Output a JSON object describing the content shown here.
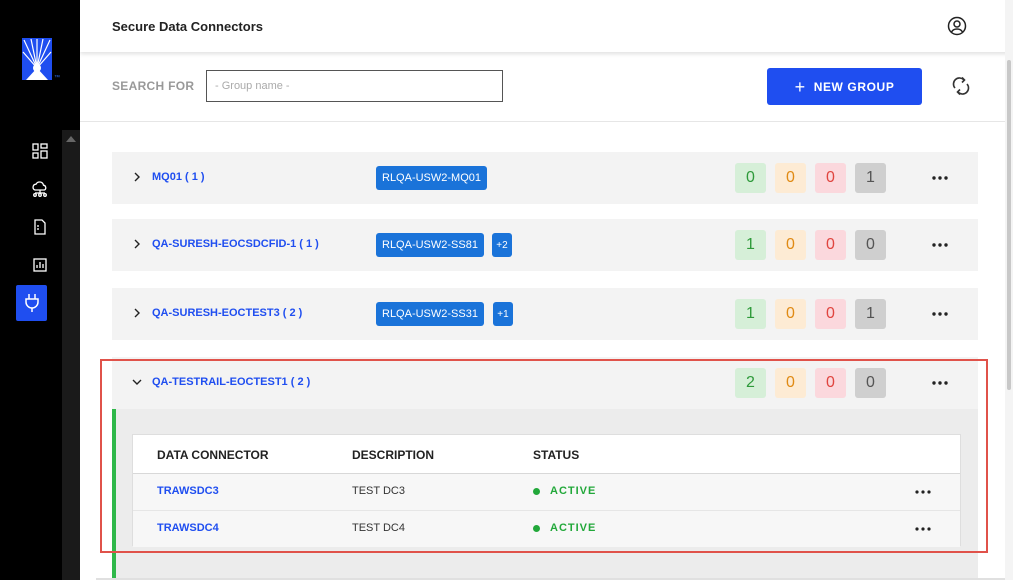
{
  "header": {
    "title": "Secure Data Connectors"
  },
  "sidebar": {
    "items": [
      {
        "icon": "dashboard-icon"
      },
      {
        "icon": "cloud-network-icon"
      },
      {
        "icon": "document-icon"
      },
      {
        "icon": "report-chart-icon"
      },
      {
        "icon": "plug-icon",
        "active": true
      }
    ]
  },
  "search": {
    "label": "SEARCH FOR",
    "placeholder": "- Group name -",
    "value": ""
  },
  "toolbar": {
    "new_group_label": "NEW GROUP"
  },
  "colors": {
    "accent": "#1f4ef0",
    "tag": "#1a73d9",
    "active_green": "#22a83a",
    "highlight_border": "#e0524a"
  },
  "groups": [
    {
      "name": "MQ01 ( 1 )",
      "tag": "RLQA-USW2-MQ01",
      "extra": "",
      "counts": [
        "0",
        "0",
        "0",
        "1"
      ],
      "expanded": false
    },
    {
      "name": "QA-SURESH-EOCSDCFID-1 ( 1 )",
      "tag": "RLQA-USW2-SS81",
      "extra": "+2",
      "counts": [
        "1",
        "0",
        "0",
        "0"
      ],
      "expanded": false
    },
    {
      "name": "QA-SURESH-EOCTEST3 ( 2 )",
      "tag": "RLQA-USW2-SS31",
      "extra": "+1",
      "counts": [
        "1",
        "0",
        "0",
        "1"
      ],
      "expanded": false
    },
    {
      "name": "QA-TESTRAIL-EOCTEST1 ( 2 )",
      "tag": "",
      "extra": "",
      "counts": [
        "2",
        "0",
        "0",
        "0"
      ],
      "expanded": true
    }
  ],
  "connectors": {
    "columns": [
      "DATA CONNECTOR",
      "DESCRIPTION",
      "STATUS"
    ],
    "rows": [
      {
        "name": "TRAWSDC3",
        "description": "TEST DC3",
        "status": "ACTIVE"
      },
      {
        "name": "TRAWSDC4",
        "description": "TEST DC4",
        "status": "ACTIVE"
      }
    ]
  }
}
